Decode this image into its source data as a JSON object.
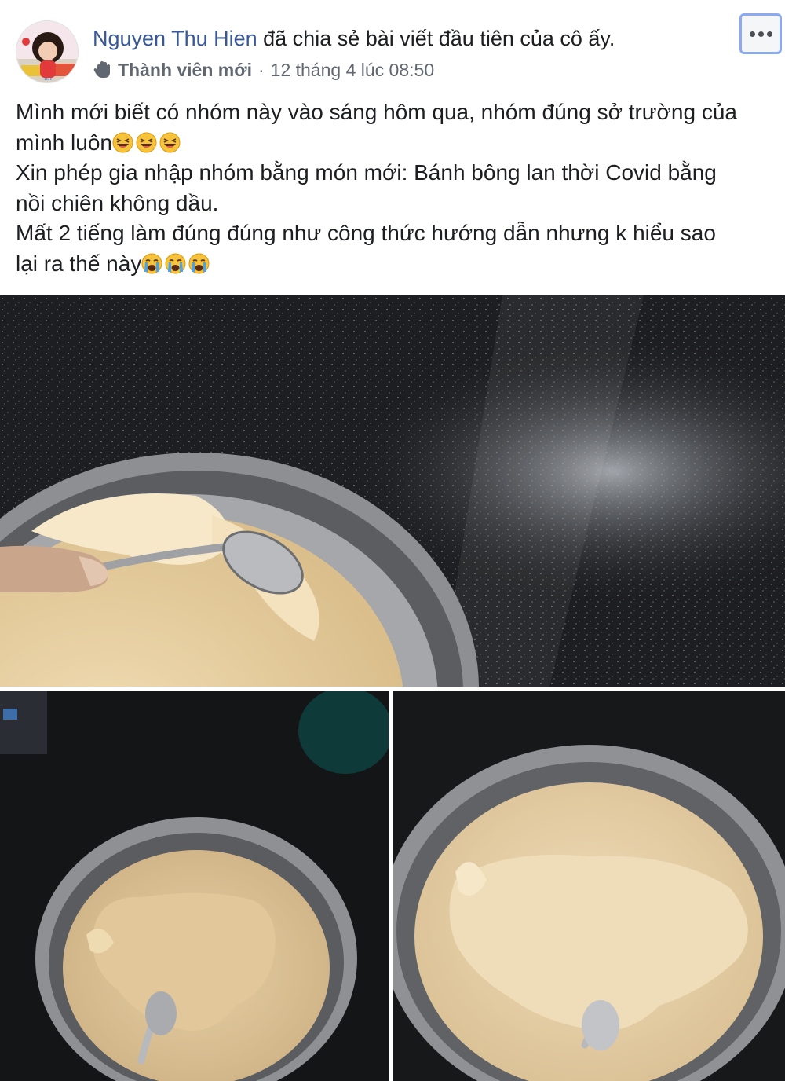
{
  "post": {
    "author_name": "Nguyen Thu Hien",
    "action_text": " đã chia sẻ bài viết đầu tiên của cô ấy.",
    "member_badge": "Thành viên mới",
    "separator": "·",
    "timestamp": "12 tháng 4 lúc 08:50",
    "more_icon": "more-dots-icon",
    "badge_icon": "wave-hand-icon",
    "lines": {
      "l1a": "Mình mới biết có nhóm này vào sáng hôm qua, nhóm đúng sở trường của",
      "l1b": "mình luôn",
      "l2a": "Xin phép gia nhập nhóm bằng món mới: Bánh bông lan thời Covid bằng",
      "l2b": "nồi chiên không dầu.",
      "l3a": "Mất 2 tiếng làm đúng đúng như công thức hướng dẫn nhưng k hiểu sao",
      "l3b": "lại ra thế này"
    },
    "emoji_laugh": "laughing-emoji",
    "emoji_cry": "crying-emoji"
  },
  "colors": {
    "author_blue": "#385898",
    "text": "#1c1e21",
    "meta_gray": "#606770",
    "focus_ring": "#8aabf2"
  }
}
